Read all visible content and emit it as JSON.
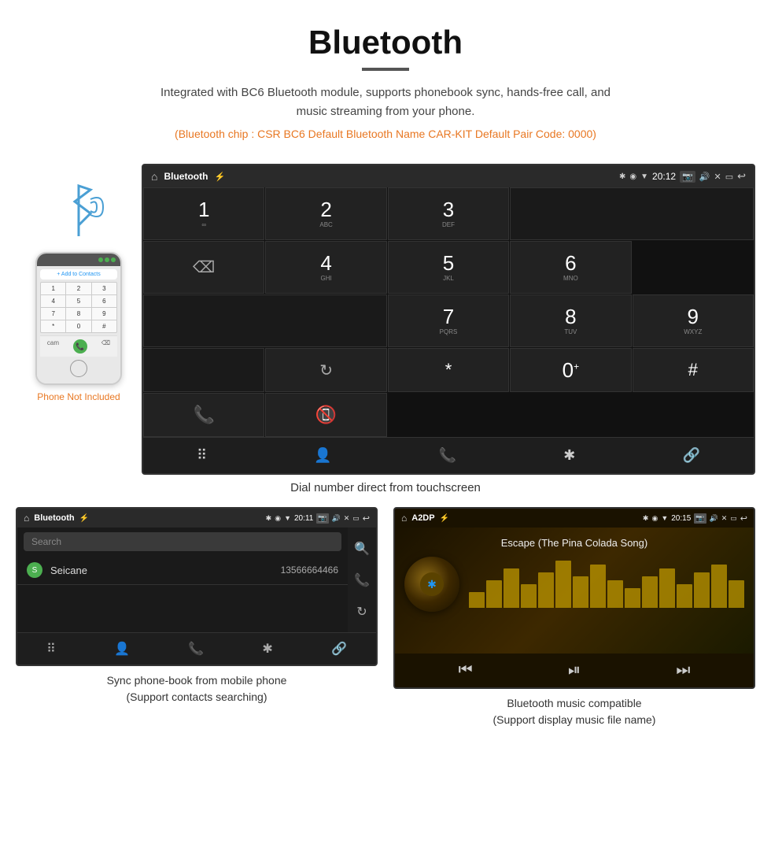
{
  "header": {
    "title": "Bluetooth",
    "description": "Integrated with BC6 Bluetooth module, supports phonebook sync, hands-free call, and music streaming from your phone.",
    "specs": "(Bluetooth chip : CSR BC6    Default Bluetooth Name CAR-KIT    Default Pair Code: 0000)"
  },
  "main_screen": {
    "status_bar": {
      "title": "Bluetooth",
      "time": "20:12"
    },
    "dial_keys": [
      {
        "number": "1",
        "letters": "∞"
      },
      {
        "number": "2",
        "letters": "ABC"
      },
      {
        "number": "3",
        "letters": "DEF"
      },
      {
        "number": "4",
        "letters": "GHI"
      },
      {
        "number": "5",
        "letters": "JKL"
      },
      {
        "number": "6",
        "letters": "MNO"
      },
      {
        "number": "7",
        "letters": "PQRS"
      },
      {
        "number": "8",
        "letters": "TUV"
      },
      {
        "number": "9",
        "letters": "WXYZ"
      },
      {
        "number": "*",
        "letters": ""
      },
      {
        "number": "0",
        "letters": "+"
      },
      {
        "number": "#",
        "letters": ""
      }
    ],
    "caption": "Dial number direct from touchscreen"
  },
  "phone_side": {
    "not_included": "Phone Not Included"
  },
  "phonebook_screen": {
    "status_bar": {
      "title": "Bluetooth",
      "time": "20:11"
    },
    "search_placeholder": "Search",
    "contact": {
      "letter": "S",
      "name": "Seicane",
      "number": "13566664466"
    },
    "caption": "Sync phone-book from mobile phone\n(Support contacts searching)"
  },
  "music_screen": {
    "status_bar": {
      "title": "A2DP",
      "time": "20:15"
    },
    "song_title": "Escape (The Pina Colada Song)",
    "eq_bars": [
      20,
      35,
      50,
      30,
      45,
      60,
      40,
      55,
      35,
      25,
      40,
      50,
      30,
      45,
      55,
      35
    ],
    "caption": "Bluetooth music compatible\n(Support display music file name)"
  },
  "icons": {
    "home": "⌂",
    "bluetooth": "Bluetooth",
    "back": "↩",
    "call_green": "📞",
    "call_red": "📵",
    "dialpad": "⠿",
    "contacts": "👤",
    "phone": "📞",
    "bt": "✱",
    "link": "🔗",
    "search": "🔍",
    "sync": "↻",
    "prev": "⏮",
    "playpause": "⏯",
    "next": "⏭"
  }
}
